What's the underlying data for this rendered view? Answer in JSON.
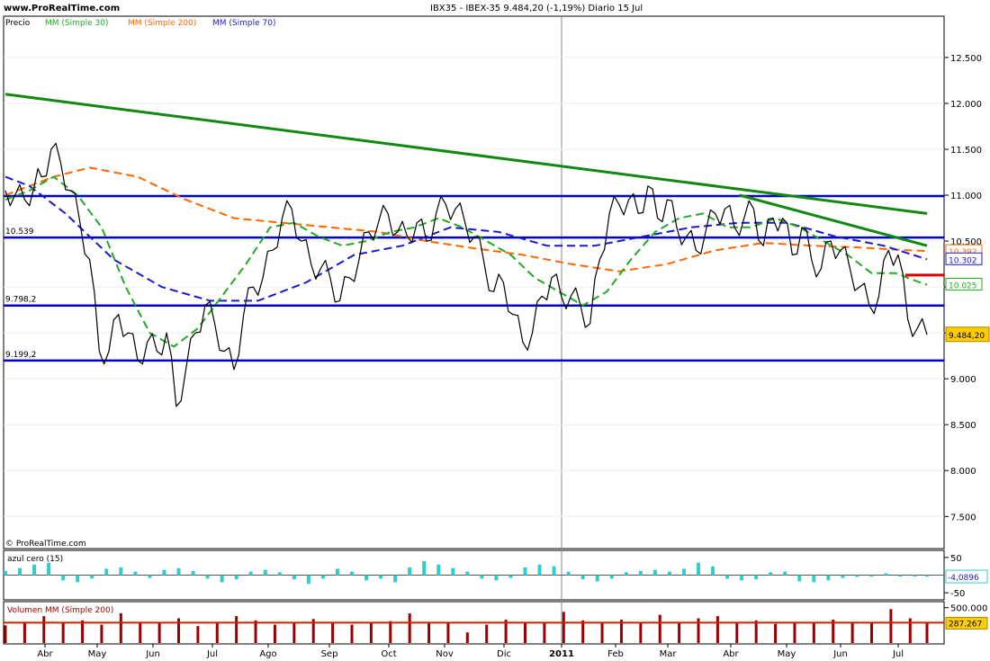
{
  "header": {
    "site": "www.ProRealTime.com",
    "title": "IBX35 - IBEX-35    9.484,20 (-1,19%)    Diario  15 Jul",
    "watermark": "© ProRealTime.com"
  },
  "legend": {
    "price": "Precio",
    "mm30": "MM (Simple 30)",
    "mm200": "MM (Simple 200)",
    "mm70": "MM (Simple 70)"
  },
  "colors": {
    "price": "#000000",
    "mm30": "#22aa22",
    "mm200": "#ff6600",
    "mm70": "#1a1acc",
    "resistance": "#0000cc",
    "trend": "#118811",
    "flag": "#dd0000",
    "indicator": "#33cccc",
    "volume": "#990000",
    "volume_mm": "#cc2200",
    "last_badge": "#ffcc00"
  },
  "chart_data": [
    {
      "type": "line",
      "title": "IBX35 - IBEX-35    9.484,20 (-1,19%)    Diario  15 Jul",
      "ylim": [
        7150,
        12950
      ],
      "ticks_y": [
        "12.500",
        "12.000",
        "11.500",
        "11.000",
        "10.500",
        "10.000",
        "9.500",
        "9.000",
        "8.500",
        "8.000",
        "7.500"
      ],
      "ticks_x": [
        "Abr",
        "May",
        "Jun",
        "Jul",
        "Ago",
        "Sep",
        "Oct",
        "Nov",
        "Dic",
        "2011",
        "Feb",
        "Mar",
        "Abr",
        "May",
        "Jun",
        "Jul"
      ],
      "series": [
        {
          "name": "Precio",
          "x": [
            0,
            4,
            8,
            12,
            15,
            19,
            23,
            27,
            31,
            35,
            39,
            43,
            47,
            51,
            55,
            59,
            63,
            67,
            71,
            75,
            79,
            83,
            87,
            91,
            95,
            99,
            103,
            107,
            111,
            115,
            119,
            123,
            127,
            131,
            135,
            139,
            143,
            147,
            151,
            155,
            159,
            163,
            167,
            171,
            175,
            179,
            183,
            187,
            191,
            195,
            199,
            203,
            207,
            211,
            215,
            219,
            223,
            227,
            231,
            235,
            239,
            243,
            247,
            251,
            255,
            259,
            263,
            267,
            271,
            275,
            279,
            283,
            287,
            291,
            295,
            299,
            303,
            307,
            311,
            315,
            319,
            323,
            327,
            331,
            335,
            339,
            343,
            347,
            351,
            355,
            359,
            363,
            367,
            371,
            375,
            379,
            383
          ],
          "values": [
            11050,
            11000,
            10950,
            11100,
            11200,
            11500,
            11350,
            11050,
            10700,
            10300,
            9300,
            9300,
            9700,
            9500,
            9200,
            9400,
            9300,
            9500,
            8700,
            9100,
            9500,
            9800,
            9600,
            9300,
            9100,
            9700,
            10000,
            10100,
            10400,
            10750,
            10850,
            10500,
            10250,
            10200,
            10100,
            9850,
            10100,
            10300,
            10600,
            10700,
            10800,
            10600,
            10550,
            10700,
            10500,
            10800,
            10900,
            10850,
            10700,
            10550,
            10250,
            9950,
            10050,
            9700,
            9400,
            9500,
            9900,
            10100,
            9900,
            9900,
            9800,
            9600,
            10300,
            10800,
            10900,
            10950,
            10800,
            11100,
            10750,
            10950,
            10650,
            10550,
            10400,
            10600,
            10800,
            10850,
            10650,
            10750,
            10850,
            10450,
            10750,
            10750,
            10350,
            10650,
            10300,
            10200,
            10500,
            10400,
            10200,
            10000,
            9800,
            9900,
            10400,
            10350,
            9650,
            9550,
            9480
          ]
        },
        {
          "name": "MM (Simple 30)",
          "x": [
            0,
            10,
            20,
            30,
            40,
            50,
            60,
            70,
            80,
            90,
            100,
            110,
            120,
            130,
            140,
            150,
            160,
            170,
            180,
            190,
            200,
            210,
            220,
            230,
            240,
            250,
            260,
            270,
            280,
            290,
            300,
            310,
            320,
            330,
            340,
            350,
            360,
            370,
            380,
            383
          ],
          "values": [
            10950,
            11050,
            11200,
            11000,
            10650,
            10000,
            9500,
            9350,
            9550,
            9900,
            10250,
            10650,
            10700,
            10550,
            10450,
            10500,
            10600,
            10650,
            10750,
            10650,
            10500,
            10350,
            10100,
            9950,
            9800,
            9950,
            10300,
            10600,
            10750,
            10800,
            10650,
            10650,
            10750,
            10650,
            10500,
            10350,
            10150,
            10150,
            10050,
            10025
          ]
        },
        {
          "name": "MM (Simple 200)",
          "x": [
            0,
            20,
            35,
            55,
            75,
            95,
            115,
            135,
            155,
            175,
            195,
            215,
            235,
            255,
            275,
            295,
            315,
            335,
            355,
            375,
            383
          ],
          "values": [
            11000,
            11200,
            11300,
            11200,
            10950,
            10750,
            10700,
            10650,
            10600,
            10500,
            10420,
            10350,
            10250,
            10170,
            10250,
            10400,
            10480,
            10450,
            10430,
            10400,
            10392
          ]
        },
        {
          "name": "MM (Simple 70)",
          "x": [
            0,
            10,
            25,
            45,
            65,
            85,
            105,
            125,
            145,
            165,
            185,
            205,
            225,
            245,
            265,
            285,
            305,
            325,
            345,
            365,
            383
          ],
          "values": [
            11200,
            11100,
            10800,
            10300,
            10000,
            9850,
            9850,
            10050,
            10350,
            10450,
            10650,
            10600,
            10450,
            10450,
            10550,
            10650,
            10700,
            10700,
            10550,
            10450,
            10302
          ]
        },
        {
          "name": "tendencia",
          "x": [
            0,
            383
          ],
          "values": [
            12100,
            10800
          ]
        },
        {
          "name": "tendencia corta",
          "x": [
            305,
            383
          ],
          "values": [
            11000,
            10450
          ]
        }
      ],
      "horizontal_levels": [
        {
          "value": 10990,
          "label": ""
        },
        {
          "value": 10539,
          "label": "10.539"
        },
        {
          "value": 9798.2,
          "label": "9.798,2"
        },
        {
          "value": 9199.2,
          "label": "9.199,2"
        }
      ],
      "right_labels": [
        {
          "value": 10392,
          "text": "10.392"
        },
        {
          "value": 10302,
          "text": "10.302"
        },
        {
          "value": 10025,
          "text": "10.025"
        },
        {
          "value": 9484.2,
          "text": "9.484,20"
        }
      ]
    },
    {
      "type": "bar",
      "title": "azul  cero (15)",
      "ylim": [
        -65,
        65
      ],
      "ticks_y": [
        "50",
        "-50"
      ],
      "last_value": "-4,0896",
      "x": [
        0,
        6,
        12,
        18,
        24,
        30,
        36,
        42,
        48,
        54,
        60,
        66,
        72,
        78,
        84,
        90,
        96,
        102,
        108,
        114,
        120,
        126,
        132,
        138,
        144,
        150,
        156,
        162,
        168,
        174,
        180,
        186,
        192,
        198,
        204,
        210,
        216,
        222,
        228,
        234,
        240,
        246,
        252,
        258,
        264,
        270,
        276,
        282,
        288,
        294,
        300,
        306,
        312,
        318,
        324,
        330,
        336,
        342,
        348,
        354,
        360,
        366,
        372,
        378,
        383
      ],
      "values": [
        12,
        20,
        30,
        35,
        -15,
        -20,
        -10,
        18,
        22,
        10,
        -8,
        15,
        20,
        12,
        -10,
        -20,
        -12,
        10,
        15,
        8,
        -12,
        -25,
        -10,
        18,
        10,
        -15,
        -10,
        -20,
        22,
        40,
        30,
        20,
        10,
        -10,
        -15,
        -8,
        22,
        30,
        25,
        10,
        -12,
        -18,
        -10,
        8,
        12,
        15,
        10,
        18,
        35,
        25,
        -10,
        -15,
        -12,
        8,
        10,
        -18,
        -20,
        -15,
        -8,
        -5,
        -4,
        5,
        -4,
        -4,
        -4
      ]
    },
    {
      "type": "bar",
      "title": "Volumen MM (Simple 200)",
      "ylim": [
        0,
        560000
      ],
      "ticks_y": [
        "500.000"
      ],
      "last_value": "287.267",
      "x": [
        0,
        8,
        16,
        24,
        32,
        40,
        48,
        56,
        64,
        72,
        80,
        88,
        96,
        104,
        112,
        120,
        128,
        136,
        144,
        152,
        160,
        168,
        176,
        184,
        192,
        200,
        208,
        216,
        224,
        232,
        240,
        248,
        256,
        264,
        272,
        280,
        288,
        296,
        304,
        312,
        320,
        328,
        336,
        344,
        352,
        360,
        368,
        376,
        383
      ],
      "values": [
        250000,
        300000,
        380000,
        280000,
        320000,
        260000,
        420000,
        300000,
        280000,
        350000,
        240000,
        300000,
        380000,
        320000,
        260000,
        280000,
        340000,
        300000,
        260000,
        290000,
        310000,
        420000,
        300000,
        280000,
        150000,
        260000,
        330000,
        300000,
        280000,
        440000,
        320000,
        300000,
        330000,
        280000,
        400000,
        300000,
        350000,
        380000,
        300000,
        320000,
        270000,
        300000,
        280000,
        330000,
        300000,
        290000,
        480000,
        350000,
        300000
      ],
      "mm": 287267
    }
  ]
}
